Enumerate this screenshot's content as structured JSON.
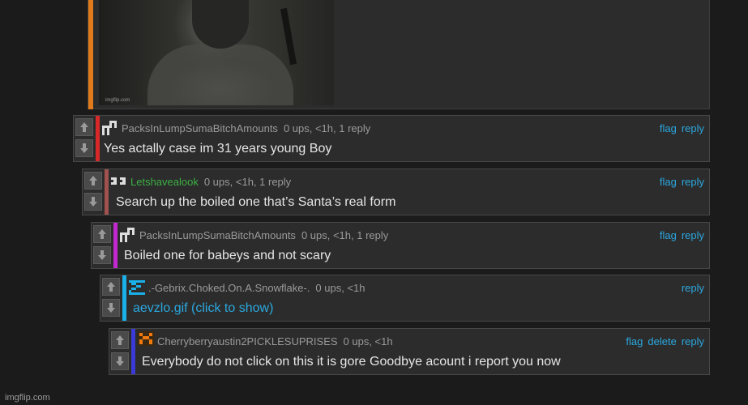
{
  "post": {
    "accent_color": "#e07a1a",
    "image_watermark": "imgflip.com"
  },
  "comments": [
    {
      "username": "PacksInLumpSumaBitchAmounts",
      "stats": "0 ups, <1h, 1 reply",
      "text": "Yes actally case im 31 years young Boy",
      "actions": [
        "flag",
        "reply"
      ],
      "accent_color": "#d82828",
      "username_color": "#9a9a9a",
      "avatar_icon": "pixel-avatar-icon"
    },
    {
      "username": "Letshavealook",
      "stats": "0 ups, <1h, 1 reply",
      "text": "Search up the boiled one that’s Santa’s real form",
      "actions": [
        "flag",
        "reply"
      ],
      "accent_color": "#a0524e",
      "username_color": "#3cb043",
      "avatar_icon": "pixel-avatar-icon"
    },
    {
      "username": "PacksInLumpSumaBitchAmounts",
      "stats": "0 ups, <1h, 1 reply",
      "text": "Boiled one for babeys and not scary",
      "actions": [
        "flag",
        "reply"
      ],
      "accent_color": "#c228d0",
      "username_color": "#9a9a9a",
      "avatar_icon": "pixel-avatar-icon"
    },
    {
      "username": ".-Gebrix.Choked.On.A.Snowflake-.",
      "stats": "0 ups, <1h",
      "text": "aevzlo.gif (click to show)",
      "actions": [
        "reply"
      ],
      "accent_color": "#1ab0e8",
      "username_color": "#9a9a9a",
      "avatar_icon": "pixel-avatar-icon"
    },
    {
      "username": "Cherryberryaustin2PICKLESUPRISES",
      "stats": "0 ups, <1h",
      "text": "Everybody do not click on this it is gore Goodbye acount i report you now",
      "actions": [
        "flag",
        "delete",
        "reply"
      ],
      "accent_color": "#3a3ad8",
      "username_color": "#9a9a9a",
      "avatar_icon": "pixel-avatar-icon"
    }
  ],
  "footer": {
    "watermark": "imgflip.com"
  }
}
